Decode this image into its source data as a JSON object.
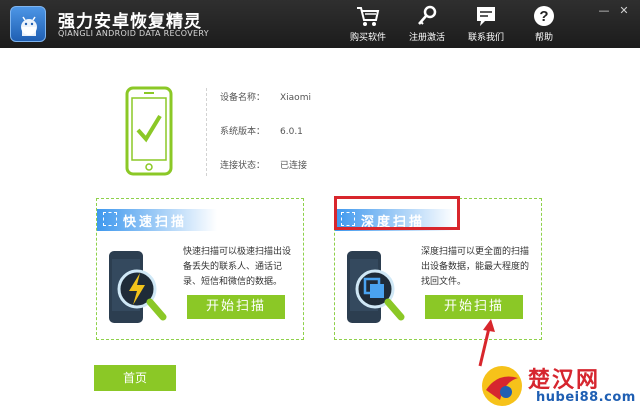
{
  "app": {
    "title": "强力安卓恢复精灵",
    "subtitle": "QIANGLI ANDROID DATA RECOVERY"
  },
  "nav": {
    "buy": "购买软件",
    "register": "注册激活",
    "contact": "联系我们",
    "help": "帮助"
  },
  "window_controls": {
    "minimize": "—",
    "close": "✕"
  },
  "device": {
    "name_label": "设备名称：",
    "name_value": "Xiaomi",
    "os_label": "系统版本：",
    "os_value": "6.0.1",
    "status_label": "连接状态：",
    "status_value": "已连接"
  },
  "quick_scan": {
    "title": "快速扫描",
    "description": "快速扫描可以极速扫描出设备丢失的联系人、通话记录、短信和微信的数据。",
    "button": "开始扫描"
  },
  "deep_scan": {
    "title": "深度扫描",
    "description": "深度扫描可以更全面的扫描出设备数据，能最大程度的找回文件。",
    "button": "开始扫描"
  },
  "home_button": "首页",
  "watermark": {
    "cn": "楚汉网",
    "en": "hubei88.com"
  },
  "colors": {
    "accent_green": "#8bc826",
    "header_blue": "#3e98ee",
    "highlight_red": "#d8262c"
  }
}
